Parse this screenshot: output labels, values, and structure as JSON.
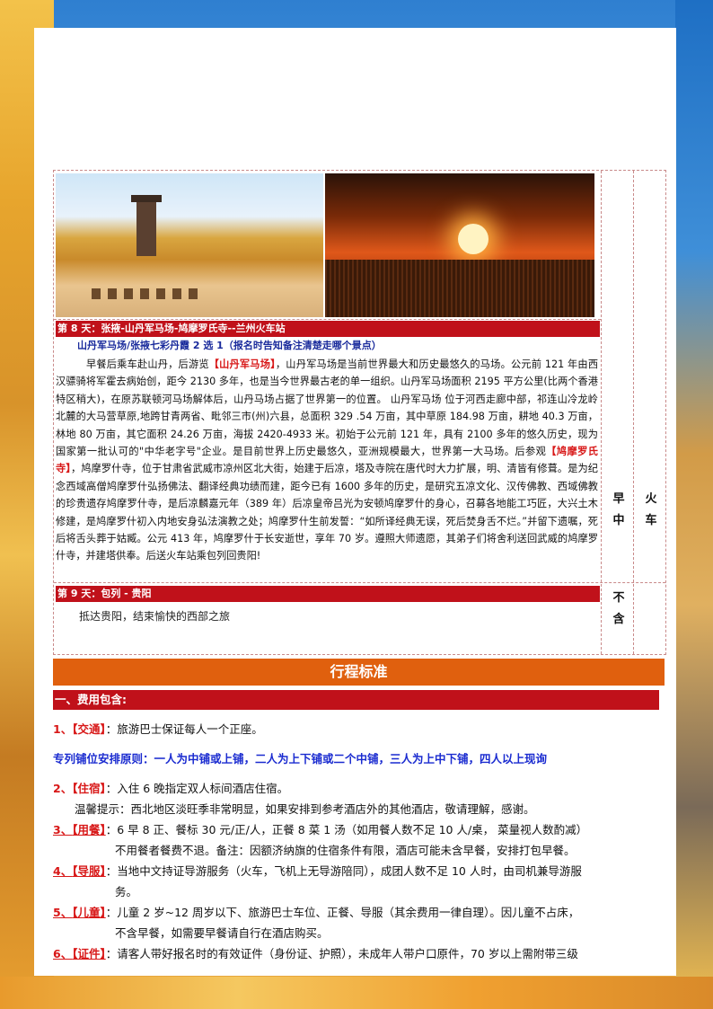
{
  "day8": {
    "title": "第 8 天：张掖-山丹军马场-鸠摩罗氏寺--兰州火车站",
    "subtitle": "山丹军马场/张掖七彩丹霞 2 选 1（报名时告知备注清楚走哪个景点）",
    "p_line1_pre": "早餐后乘车赴山丹，后游览",
    "p_hl1": "【山丹军马场】",
    "p_line1_post": "，山丹军马场是当前世界最大和历史最悠久的马场。公元前 121 年由西汉骠骑将军霍去病始创，距今 2130 多年，也是当今世界最古老的单一组织。山丹军马场面积 2195 平方公里(比两个香港特区稍大)，在原苏联顿河马场解体后，山丹马场占据了世界第一的位置。 山丹军马场 位于河西走廊中部，祁连山冷龙岭北麓的大马营草原,地跨甘青两省、毗邻三市(州)六县，总面积 329 .54 万亩，其中草原 184.98 万亩，耕地 40.3 万亩，林地 80 万亩，其它面积 24.26 万亩，海拔 2420-4933 米。初始于公元前 121 年，具有 2100 多年的悠久历史，现为国家第一批认可的\"中华老字号\"企业。是目前世界上历史最悠久，亚洲规模最大，世界第一大马场。后参观",
    "p_hl2": "【鸠摩罗氏寺】",
    "p_line2_post": "，鸠摩罗什寺，位于甘肃省武威市凉州区北大街，始建于后凉，塔及寺院在唐代时大力扩展，明、清皆有修葺。是为纪念西域高僧鸠摩罗什弘扬佛法、翻译经典功绩而建，距今已有 1600 多年的历史，是研究五凉文化、汉传佛教、西域佛教的珍贵遗存鸠摩罗什寺，是后凉麟嘉元年（389 年）后凉皇帝吕光为安顿鸠摩罗什的身心，召募各地能工巧匠，大兴土木修建，是鸠摩罗什初入内地安身弘法演教之处；鸠摩罗什生前发誓：“如所译经典无误，死后焚身舌不烂。”并留下遗嘱，死后将舌头葬于姑臧。公元 413 年，鸠摩罗什于长安逝世，享年 70 岁。遵照大师遗愿，其弟子们将舍利送回武威的鸠摩罗什寺，并建塔供奉。后送火车站乘包列回贵阳!",
    "meal": [
      "早",
      "中"
    ],
    "hotel": [
      "火",
      "车"
    ]
  },
  "day9": {
    "title": "第 9 天：包列 - 贵阳",
    "text": "抵达贵阳，结束愉快的西部之旅",
    "meal": [
      "不",
      "含"
    ]
  },
  "standard": {
    "title": "行程标准",
    "fee_header": "一、费用包含:",
    "items": [
      {
        "num": "1、",
        "tag": "【交通】",
        "text": "：旅游巴士保证每人一个正座。"
      },
      {
        "rule": "专列铺位安排原则：一人为中铺或上铺，二人为上下铺或二个中铺，三人为上中下铺，四人以上现询"
      },
      {
        "num": "2、",
        "tag": "【住宿】",
        "text": "：入住 6 晚指定双人标间酒店住宿。",
        "cont": "温馨提示：西北地区淡旺季非常明显，如果安排到参考酒店外的其他酒店，敬请理解，感谢。"
      },
      {
        "num": "3、",
        "tag": "【用餐】",
        "text": "：6 早 8 正、餐标 30 元/正/人，正餐 8 菜 1 汤（如用餐人数不足 10 人/桌，  菜量视人数酌减）",
        "cont": "不用餐者餐费不退。备注：因额济纳旗的住宿条件有限，酒店可能未含早餐，安排打包早餐。"
      },
      {
        "num": "4、",
        "tag": "【导服】",
        "text": "：当地中文持证导游服务（火车，飞机上无导游陪同），成团人数不足 10 人时，由司机兼导游服",
        "cont": "务。"
      },
      {
        "num": "5、",
        "tag": "【儿童】",
        "text": "：儿童 2 岁~12 周岁以下、旅游巴士车位、正餐、导服（其余费用一律自理）。因儿童不占床，",
        "cont": "不含早餐，如需要早餐请自行在酒店购买。"
      },
      {
        "num": "6、",
        "tag": "【证件】",
        "text": "：请客人带好报名时的有效证件（身份证、护照），未成年人带户口原件，70 岁以上需附带三级"
      }
    ]
  }
}
